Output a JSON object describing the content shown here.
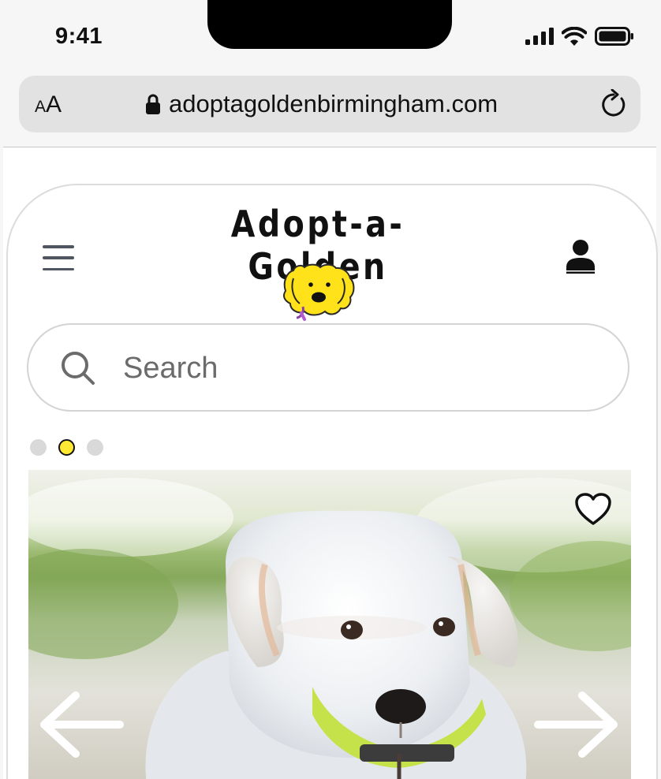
{
  "status_bar": {
    "time": "9:41"
  },
  "browser": {
    "text_size_label": "AA",
    "url": "adoptagoldenbirmingham.com"
  },
  "header": {
    "brand": "Adopt-a-Golden",
    "logo_icon": "dog-face-icon"
  },
  "search": {
    "placeholder": "Search"
  },
  "carousel": {
    "slide_count": 3,
    "active_index": 1,
    "image": "white-puppy-photo",
    "colors": {
      "active_dot": "#ffe833",
      "inactive_dot": "#d9d9d9"
    }
  }
}
